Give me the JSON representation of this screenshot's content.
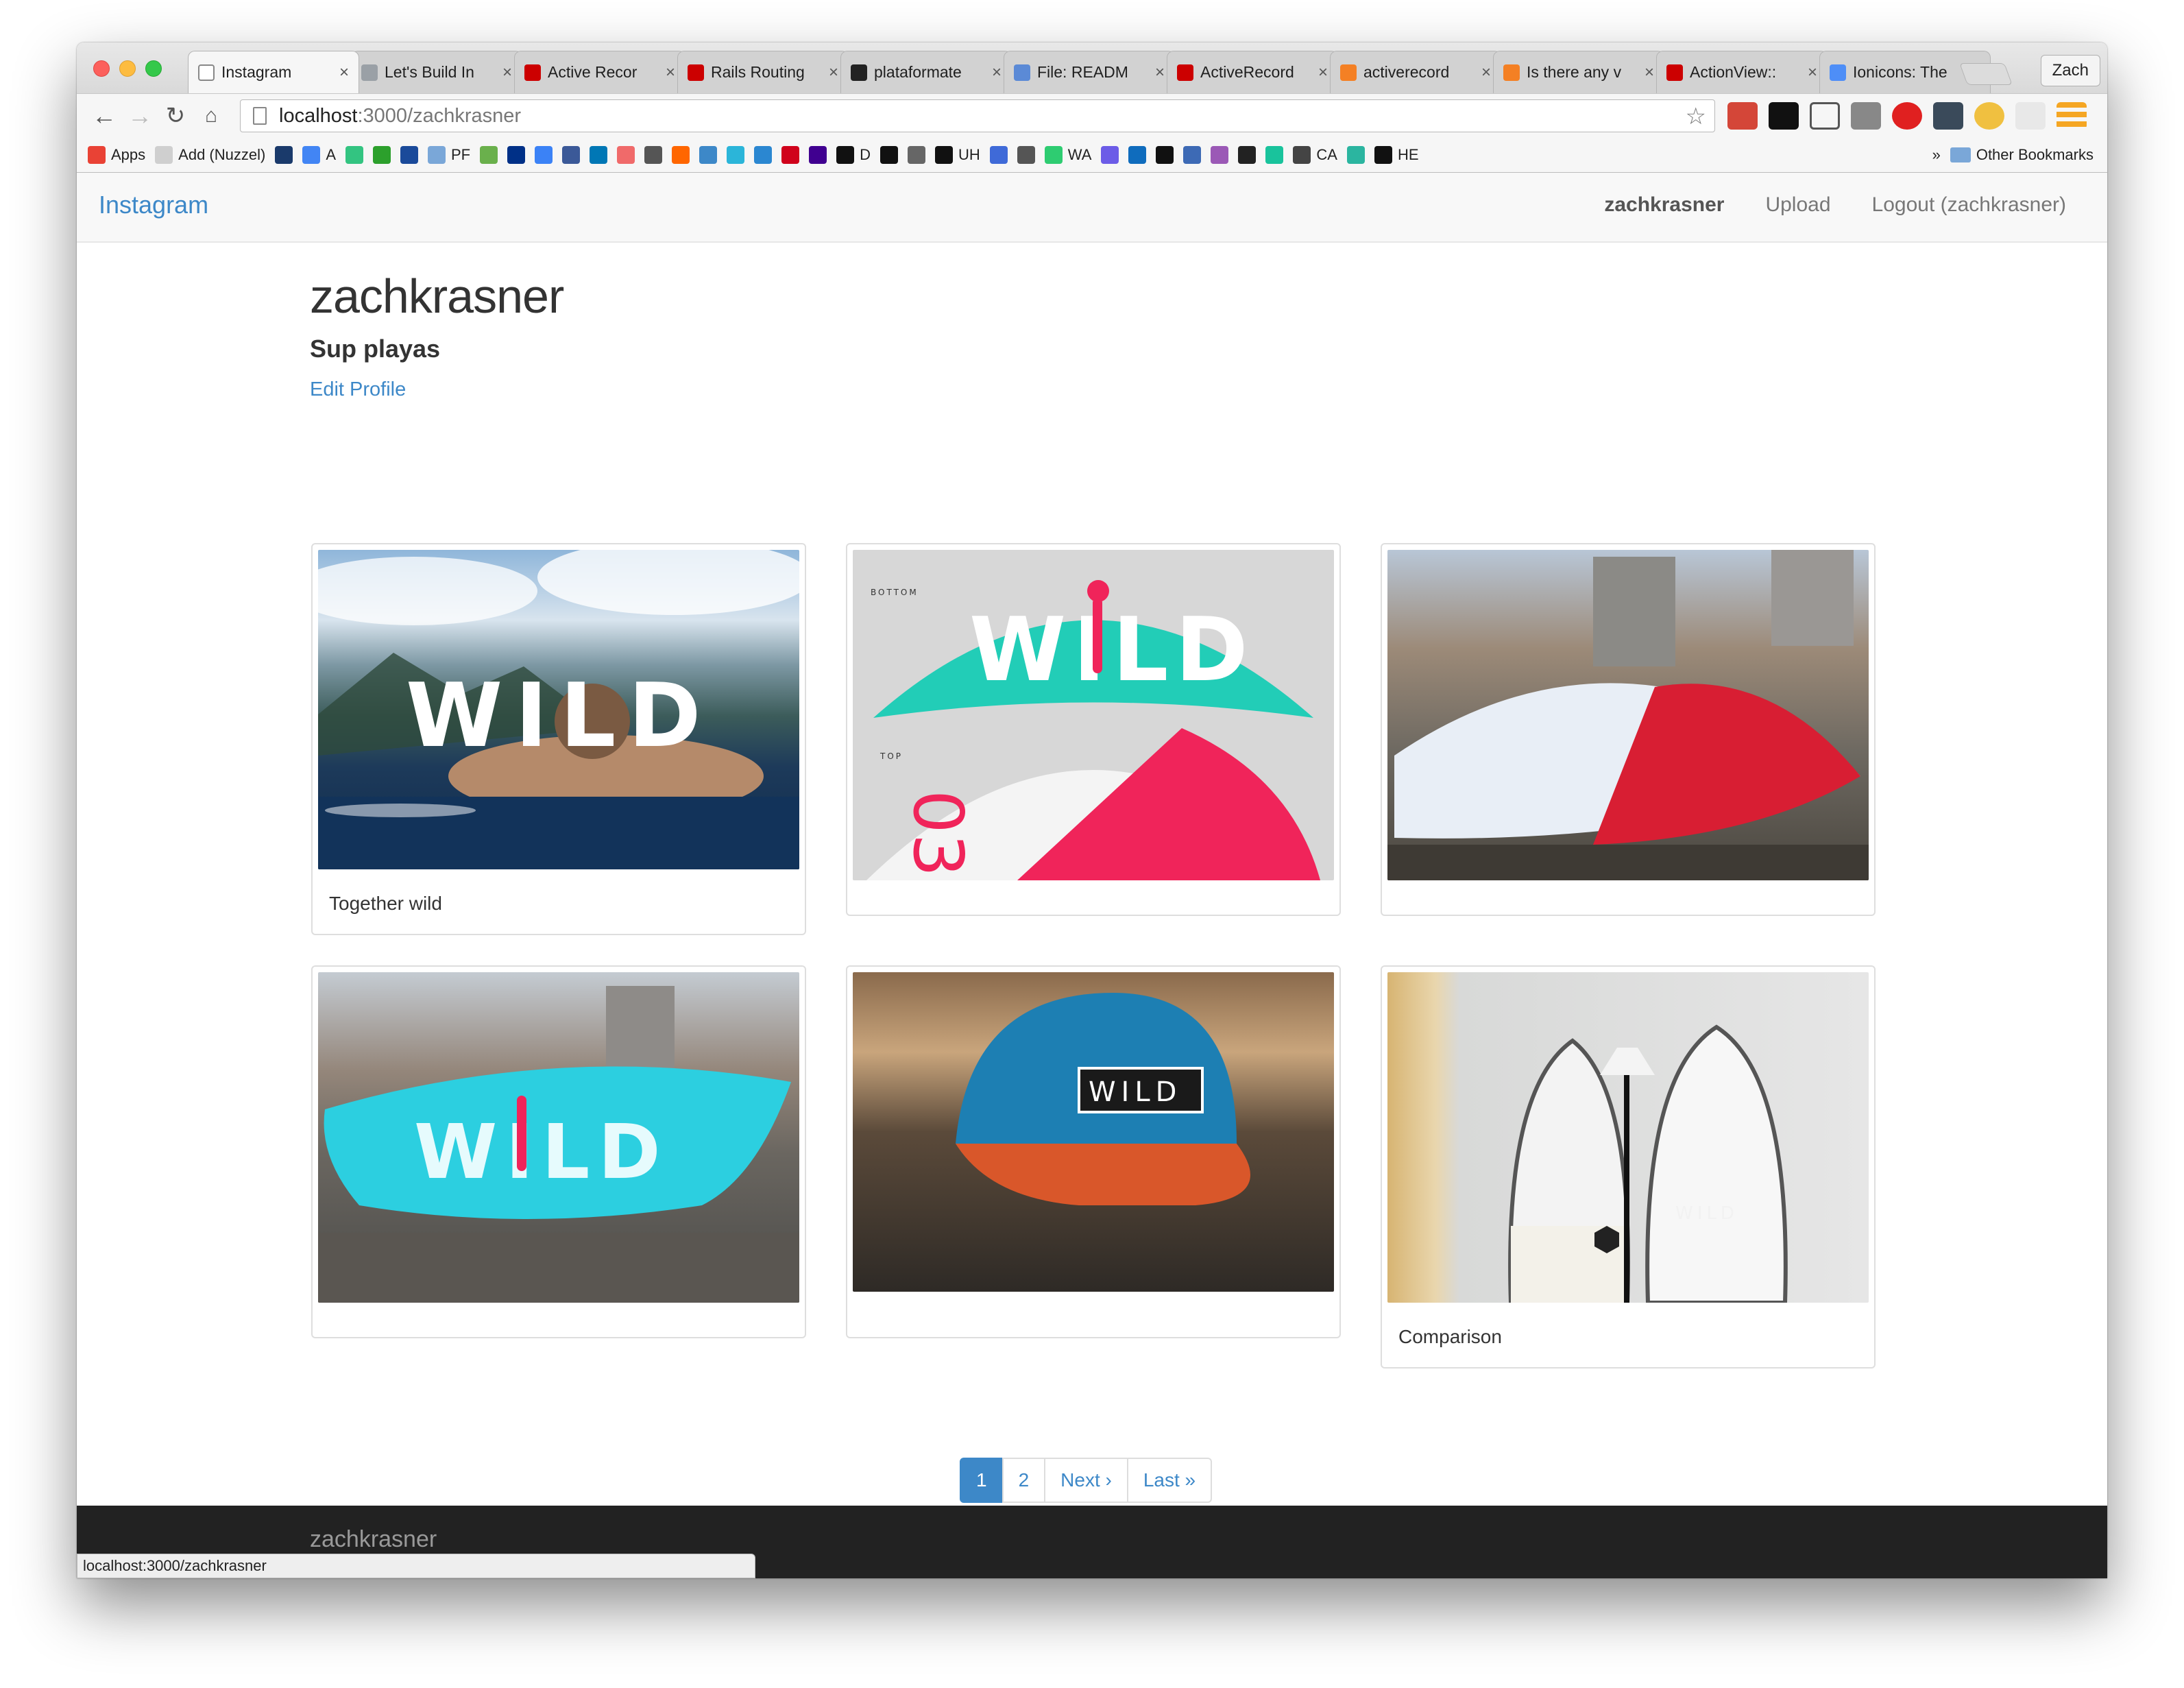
{
  "browser": {
    "profile": "Zach",
    "tabs": [
      {
        "label": "Instagram",
        "color": "#ffffff",
        "active": true
      },
      {
        "label": "Let's Build In",
        "color": "#9aa0a6"
      },
      {
        "label": "Active Recor",
        "color": "#cc0000"
      },
      {
        "label": "Rails Routing",
        "color": "#cc0000"
      },
      {
        "label": "plataformate",
        "color": "#222222"
      },
      {
        "label": "File: READM",
        "color": "#5b8ad6"
      },
      {
        "label": "ActiveRecord",
        "color": "#cc0000"
      },
      {
        "label": "activerecord",
        "color": "#f48024"
      },
      {
        "label": "Is there any v",
        "color": "#f48024"
      },
      {
        "label": "ActionView::",
        "color": "#cc0000"
      },
      {
        "label": "Ionicons: The",
        "color": "#4e8ef7"
      }
    ],
    "url_host": "localhost",
    "url_rest": ":3000/zachkrasner",
    "bookmarks": [
      {
        "label": "Apps",
        "color": "#e94235"
      },
      {
        "label": "Add (Nuzzel)",
        "color": "#cfcfcf"
      },
      {
        "label": "",
        "color": "#1a3a6b"
      },
      {
        "label": "A",
        "color": "#4285f4"
      },
      {
        "label": "",
        "color": "#33c481"
      },
      {
        "label": "",
        "color": "#2ca02c"
      },
      {
        "label": "",
        "color": "#1a4a9a"
      },
      {
        "label": "PF",
        "color": "#7aa7d8"
      },
      {
        "label": "",
        "color": "#6ab04c"
      },
      {
        "label": "",
        "color": "#003087"
      },
      {
        "label": "",
        "color": "#3b82f6"
      },
      {
        "label": "",
        "color": "#3b5998"
      },
      {
        "label": "",
        "color": "#0077b5"
      },
      {
        "label": "",
        "color": "#f06a6a"
      },
      {
        "label": "",
        "color": "#555555"
      },
      {
        "label": "",
        "color": "#ff6600"
      },
      {
        "label": "",
        "color": "#3d88c8"
      },
      {
        "label": "",
        "color": "#2bb5d9"
      },
      {
        "label": "",
        "color": "#2b87d1"
      },
      {
        "label": "",
        "color": "#d0021b"
      },
      {
        "label": "",
        "color": "#400090"
      },
      {
        "label": "D",
        "color": "#111111"
      },
      {
        "label": "",
        "color": "#111111"
      },
      {
        "label": "",
        "color": "#666666"
      },
      {
        "label": "UH",
        "color": "#111111"
      },
      {
        "label": "",
        "color": "#3f6ad8"
      },
      {
        "label": "",
        "color": "#555555"
      },
      {
        "label": "WA",
        "color": "#2ecc71"
      },
      {
        "label": "",
        "color": "#6c5ce7"
      },
      {
        "label": "",
        "color": "#0f6cbd"
      },
      {
        "label": "",
        "color": "#111111"
      },
      {
        "label": "",
        "color": "#3d6ab5"
      },
      {
        "label": "",
        "color": "#9b59b6"
      },
      {
        "label": "",
        "color": "#222222"
      },
      {
        "label": "",
        "color": "#19c39c"
      },
      {
        "label": "CA",
        "color": "#444444"
      },
      {
        "label": "",
        "color": "#2bb5a0"
      },
      {
        "label": "HE",
        "color": "#111111"
      }
    ],
    "overflow_chevron": "»",
    "other_bookmarks": "Other Bookmarks",
    "status_url": "localhost:3000/zachkrasner"
  },
  "navbar": {
    "brand": "Instagram",
    "links": [
      "zachkrasner",
      "Upload",
      "Logout (zachkrasner)"
    ]
  },
  "profile": {
    "username": "zachkrasner",
    "bio": "Sup playas",
    "edit_link": "Edit Profile"
  },
  "posts": [
    {
      "caption": "Together wild",
      "image": "surfer with WILD overlay"
    },
    {
      "caption": "",
      "image": "WILD kite design bottom and top"
    },
    {
      "caption": "",
      "image": "red and white kite on railing"
    },
    {
      "caption": "",
      "image": "turquoise WILD kite on railing"
    },
    {
      "caption": "",
      "image": "blue WILD cap with red brim"
    },
    {
      "caption": "Comparison",
      "image": "two surfboards against wall"
    }
  ],
  "pagination": [
    "1",
    "2",
    "Next ›",
    "Last »"
  ],
  "footer": {
    "text": "zachkrasner"
  },
  "colors": {
    "link": "#3d88c8",
    "footer": "#222222",
    "kite_pink": "#f0245a",
    "kite_teal": "#22cdb7"
  }
}
